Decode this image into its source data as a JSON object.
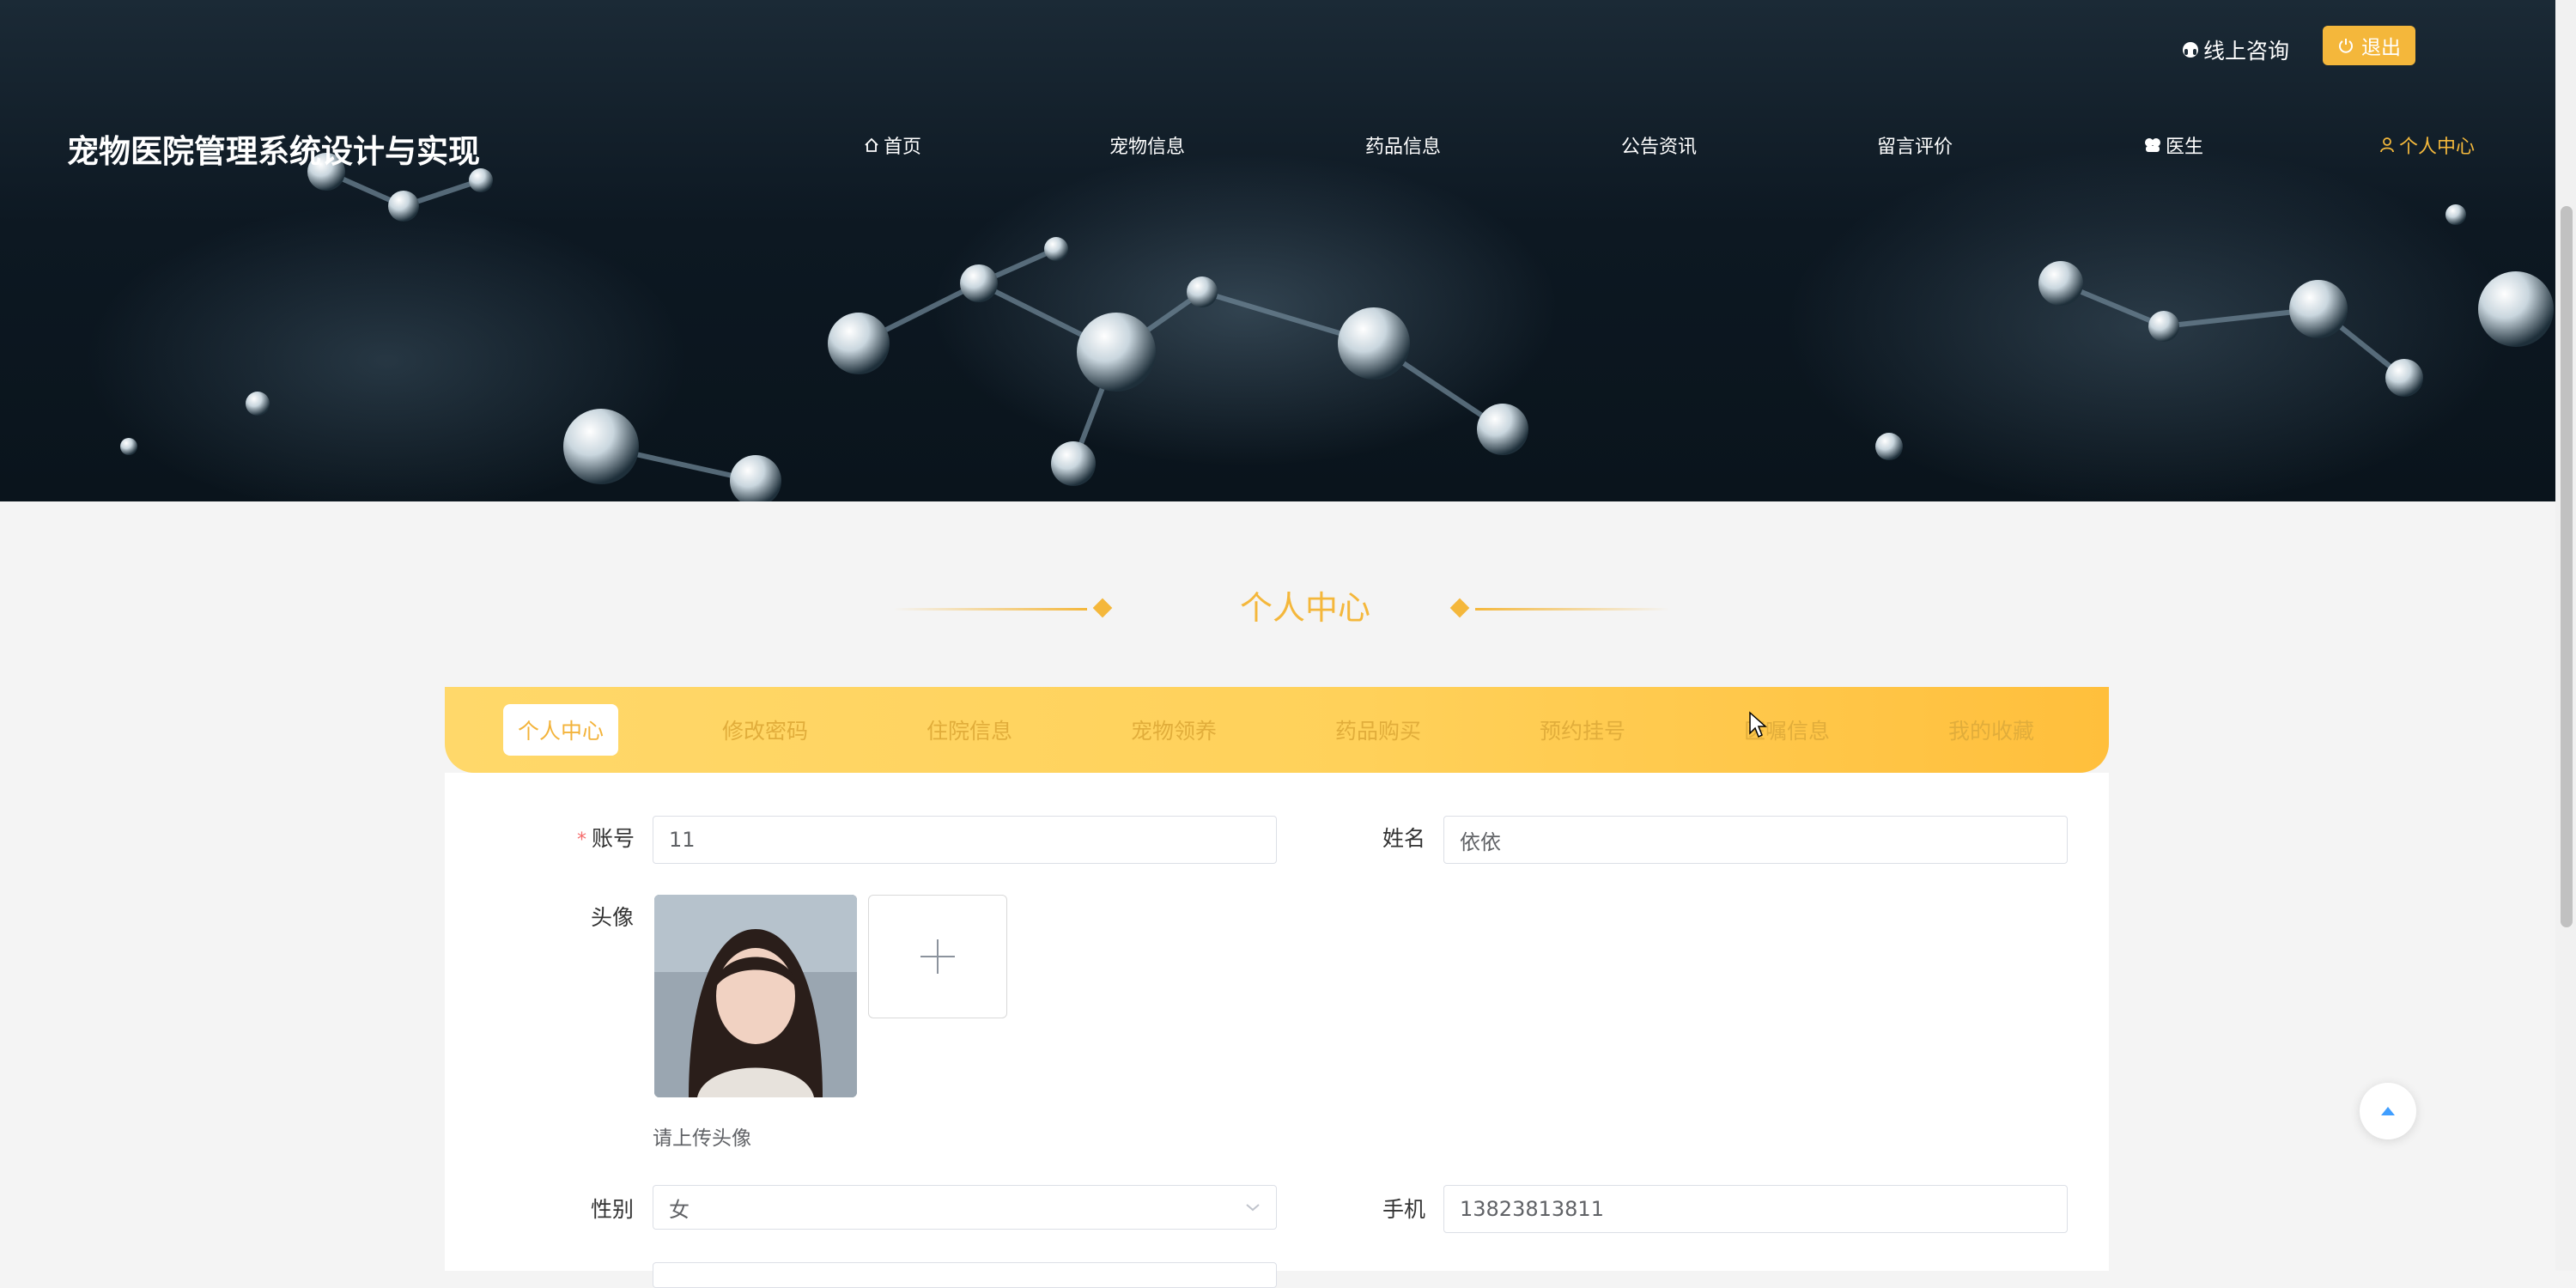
{
  "header": {
    "site_title": "宠物医院管理系统设计与实现",
    "consult_label": "线上咨询",
    "logout_label": "退出",
    "nav": [
      {
        "label": "首页",
        "icon": "home-icon"
      },
      {
        "label": "宠物信息"
      },
      {
        "label": "药品信息"
      },
      {
        "label": "公告资讯"
      },
      {
        "label": "留言评价"
      },
      {
        "label": "医生",
        "icon": "doctor-icon"
      },
      {
        "label": "个人中心",
        "icon": "user-icon",
        "active": true
      }
    ]
  },
  "section": {
    "title": "个人中心"
  },
  "tabs": [
    {
      "label": "个人中心",
      "active": true
    },
    {
      "label": "修改密码"
    },
    {
      "label": "住院信息"
    },
    {
      "label": "宠物领养"
    },
    {
      "label": "药品购买"
    },
    {
      "label": "预约挂号"
    },
    {
      "label": "医嘱信息"
    },
    {
      "label": "我的收藏"
    }
  ],
  "form": {
    "account": {
      "label": "账号",
      "value": "11",
      "required": true
    },
    "name": {
      "label": "姓名",
      "value": "依依"
    },
    "avatar": {
      "label": "头像",
      "hint": "请上传头像"
    },
    "gender": {
      "label": "性别",
      "value": "女"
    },
    "phone": {
      "label": "手机",
      "value": "13823813811"
    }
  },
  "colors": {
    "accent": "#f4b73b",
    "tab_bar_start": "#ffd86a",
    "tab_bar_end": "#ffbf3c",
    "required": "#f56c6c",
    "back_top_arrow": "#409eff"
  }
}
